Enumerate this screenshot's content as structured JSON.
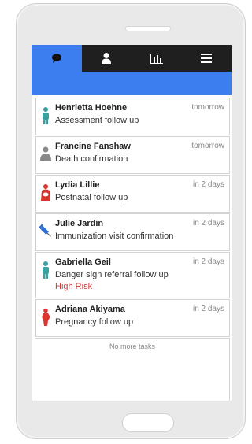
{
  "nav": {
    "tabs": [
      {
        "icon": "messages-icon",
        "active": true
      },
      {
        "icon": "person-icon",
        "active": false
      },
      {
        "icon": "bar-chart-icon",
        "active": false
      },
      {
        "icon": "menu-icon",
        "active": false
      }
    ]
  },
  "tasks": [
    {
      "name": "Henrietta Hoehne",
      "date": "tomorrow",
      "desc": "Assessment follow up",
      "icon": "person-teal-icon"
    },
    {
      "name": "Francine Fanshaw",
      "date": "tomorrow",
      "desc": "Death confirmation",
      "icon": "person-gray-icon"
    },
    {
      "name": "Lydia Lillie",
      "date": "in 2 days",
      "desc": "Postnatal follow up",
      "icon": "mother-baby-icon"
    },
    {
      "name": "Julie Jardin",
      "date": "in 2 days",
      "desc": "Immunization visit confirmation",
      "icon": "syringe-icon"
    },
    {
      "name": "Gabriella Geil",
      "date": "in 2 days",
      "desc": "Danger sign referral follow up",
      "risk": "High Risk",
      "icon": "person-teal-icon"
    },
    {
      "name": "Adriana Akiyama",
      "date": "in 2 days",
      "desc": "Pregnancy follow up",
      "icon": "pregnancy-icon"
    }
  ],
  "footer": {
    "no_more": "No more tasks"
  },
  "colors": {
    "accent": "#3c7ef0",
    "tabbar": "#1f1f1f",
    "risk": "#d23b3b"
  }
}
